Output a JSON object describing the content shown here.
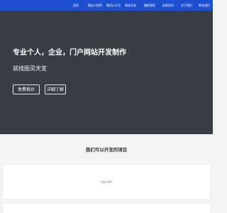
{
  "nav": {
    "items": [
      "首页",
      "微信小程序",
      "微信公众号",
      "网站开发",
      "最新案例",
      "新闻资讯",
      "关于我们",
      "联系我们"
    ]
  },
  "hero": {
    "title": "专业个人，企业，门户网站开发制作",
    "subtitle": "就找图灵天宜",
    "buttons": {
      "quote": "免费报价",
      "detail": "详细了解"
    }
  },
  "services": {
    "title": "我们可以开发的项目",
    "cards": [
      {
        "label": "IOS APP"
      }
    ]
  },
  "colors": {
    "nav_bg": "#1f4fd1",
    "hero_bg": "#3a3d44",
    "page_bg": "#f4f4f4"
  }
}
